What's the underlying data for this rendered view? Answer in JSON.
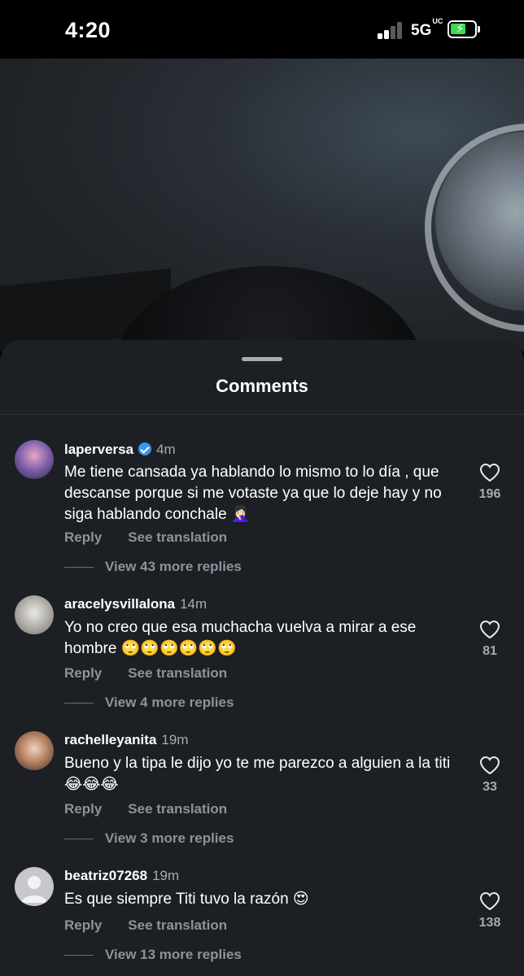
{
  "status_bar": {
    "time": "4:20",
    "network": "5G",
    "network_suffix": "UC"
  },
  "sheet": {
    "title": "Comments"
  },
  "comments": [
    {
      "username": "laperversa",
      "verified": true,
      "time_ago": "4m",
      "text": "Me tiene cansada ya hablando lo mismo to lo día , que descanse porque si me votaste ya que lo deje hay y no siga hablando conchale 🤦🏻‍♀️",
      "reply_label": "Reply",
      "translate_label": "See translation",
      "view_replies": "View 43 more replies",
      "likes": "196",
      "avatar_color": "#4b3f6b"
    },
    {
      "username": "aracelysvillalona",
      "verified": false,
      "time_ago": "14m",
      "text": "Yo no creo que esa muchacha vuelva a mirar a ese hombre 🙄🙄🙄🙄🙄🙄",
      "reply_label": "Reply",
      "translate_label": "See translation",
      "view_replies": "View 4 more replies",
      "likes": "81",
      "avatar_color": "#9aa0a4"
    },
    {
      "username": "rachelleyanita",
      "verified": false,
      "time_ago": "19m",
      "text": "Bueno y la tipa le dijo yo te me parezco a alguien a la titi 😂😂😂",
      "reply_label": "Reply",
      "translate_label": "See translation",
      "view_replies": "View 3 more replies",
      "likes": "33",
      "avatar_color": "#a97b5e"
    },
    {
      "username": "beatriz07268",
      "verified": false,
      "time_ago": "19m",
      "text": "Es que siempre Titi tuvo la razón 😍",
      "reply_label": "Reply",
      "translate_label": "See translation",
      "view_replies": "View 13 more replies",
      "likes": "138",
      "avatar_color": "#c7c7cc"
    }
  ]
}
